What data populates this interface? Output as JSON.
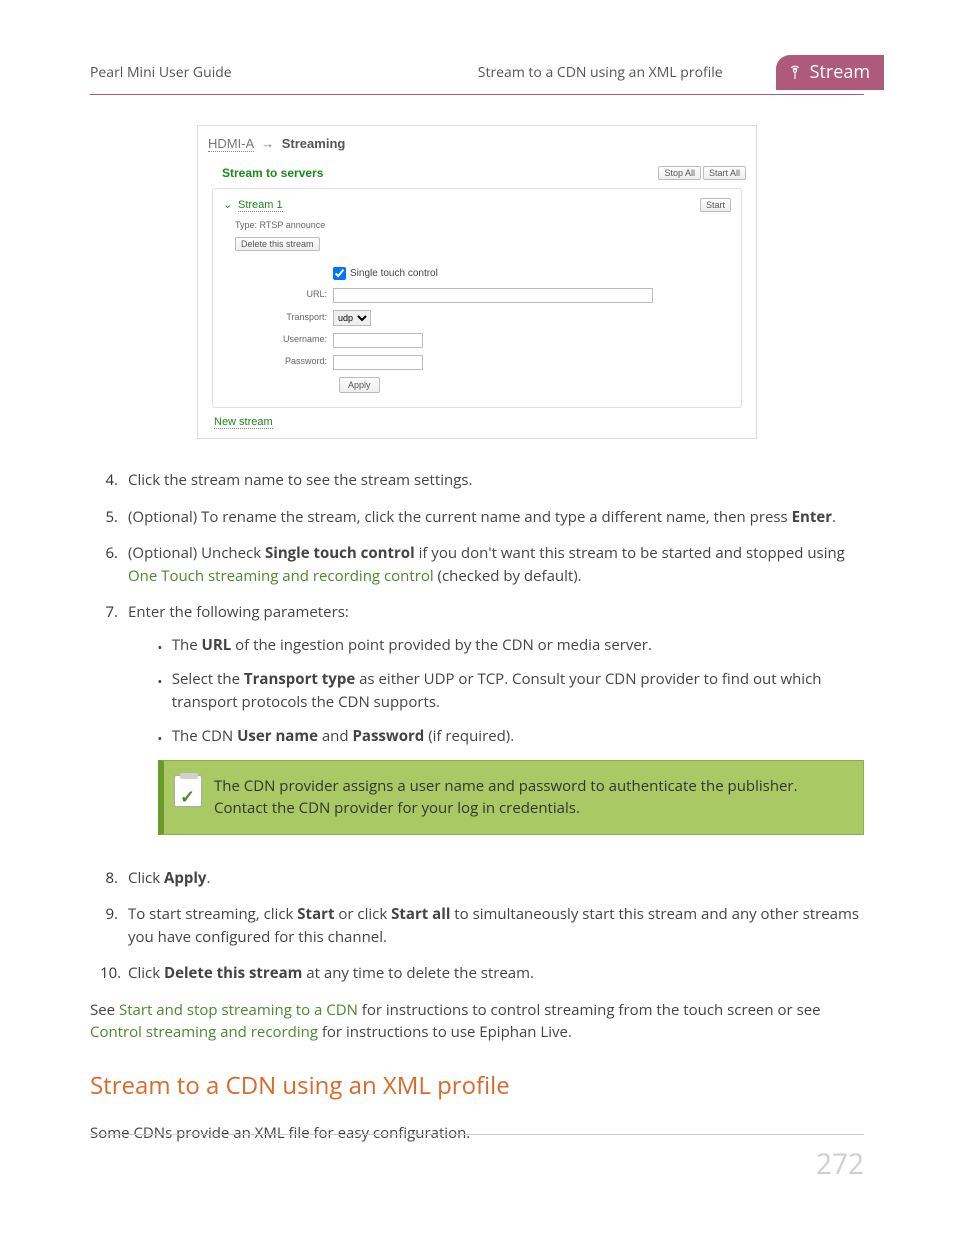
{
  "header": {
    "left": "Pearl Mini User Guide",
    "mid": "Stream to a CDN using an XML profile",
    "tab": "Stream"
  },
  "panel": {
    "breadcrumb_a": "HDMI-A",
    "breadcrumb_b": "Streaming",
    "title": "Stream to servers",
    "stop_all": "Stop All",
    "start_all": "Start All",
    "stream_name": "Stream 1",
    "start": "Start",
    "type": "Type: RTSP announce",
    "delete": "Delete this stream",
    "single_touch": "Single touch control",
    "url_label": "URL:",
    "transport_label": "Transport:",
    "transport_value": "udp",
    "username_label": "Username:",
    "password_label": "Password:",
    "apply": "Apply",
    "new_stream": "New stream"
  },
  "steps": {
    "s4": {
      "n": "4.",
      "t": "Click the stream name to see the stream settings."
    },
    "s5": {
      "n": "5.",
      "t1": "(Optional) To rename the stream, click the current name and type a different name, then press ",
      "b": "Enter",
      "t2": "."
    },
    "s6": {
      "n": "6.",
      "t1": "(Optional) Uncheck ",
      "b": "Single touch control",
      "t2": " if you don't want this stream to be started and stopped using ",
      "link": "One Touch streaming and recording control",
      "t3": " (checked by default)."
    },
    "s7": {
      "n": "7.",
      "t": "Enter the following parameters:"
    },
    "s8": {
      "n": "8.",
      "t1": "Click ",
      "b": "Apply",
      "t2": "."
    },
    "s9": {
      "n": "9.",
      "t1": "To start streaming, click ",
      "b1": "Start",
      "t2": " or click ",
      "b2": "Start all",
      "t3": " to simultaneously start this stream and any other streams you have configured for this channel."
    },
    "s10": {
      "n": "10.",
      "t1": "Click ",
      "b": "Delete this stream",
      "t2": " at any time to delete the stream."
    }
  },
  "bullets": {
    "b1": {
      "t1": "The ",
      "b": "URL",
      "t2": " of the ingestion point provided by the CDN or media server."
    },
    "b2": {
      "t1": "Select the ",
      "b": "Transport type",
      "t2": " as either UDP or TCP. Consult your CDN provider to find out which transport protocols the CDN supports."
    },
    "b3": {
      "t1": "The CDN ",
      "b1": "User name",
      "t2": " and ",
      "b2": "Password",
      "t3": " (if required)."
    }
  },
  "callout": "The CDN provider assigns a user name and password to authenticate the publisher. Contact the CDN provider for your log in credentials.",
  "closing": {
    "t1": "See ",
    "link1": "Start and stop streaming to a CDN",
    "t2": " for instructions to control streaming from the touch screen or see ",
    "link2": "Control streaming and recording",
    "t3": " for instructions to use Epiphan Live."
  },
  "section_title": "Stream to a CDN using an XML profile",
  "section_body": "Some CDNs provide an XML file for easy configuration.",
  "page_number": "272"
}
